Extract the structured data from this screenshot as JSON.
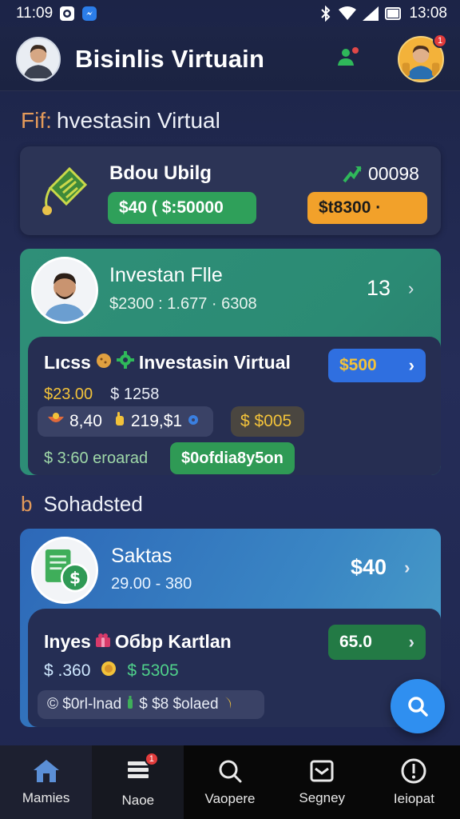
{
  "status_bar": {
    "time": "11:09",
    "clock_right": "13:08"
  },
  "header": {
    "title": "Bisinlis Virtuain",
    "notif_count": "1"
  },
  "section1": {
    "prefix": "Fif:",
    "title": "hvestasin Virtual"
  },
  "summary_card": {
    "title": "Bdou Ubilg",
    "trend_value": "00098",
    "green_pill": "$40 ( $:50000",
    "orange_pill": "$t8300 ·"
  },
  "investor_card": {
    "name": "Investan Flle",
    "values": "$2300 : 1.677 · 6308",
    "count": "13",
    "inner": {
      "title_prefix": "Lıcss",
      "title": "Investasin Virtual",
      "amount_yellow": "$23.00",
      "amount_white": "$ 1258",
      "blue_pill": "$500",
      "chip1": "8,40",
      "chip2": "219,$1",
      "chip3": "$ $005",
      "footer_text": "$ 3:60  eroarad",
      "green_button": "$0ofdia8y5on"
    }
  },
  "section2": {
    "prefix": "b",
    "title": "Sohadsted"
  },
  "sales_card": {
    "title": "Saktas",
    "values": "29.00 - 380",
    "amount": "$40",
    "inner": {
      "title_prefix": "Inyes",
      "title": "Oбbp Kartlan",
      "amount_cyan": "$ .360",
      "amount_green": "$ 5305",
      "green_pill": "65.0",
      "chip_text": "© $0rl-lnad",
      "chip_text2": "$ $8 $olaed"
    }
  },
  "bottom_nav": [
    {
      "label": "Mamies",
      "icon": "home-icon"
    },
    {
      "label": "Naoe",
      "icon": "stack-icon",
      "badge": "1"
    },
    {
      "label": "Vaopere",
      "icon": "search-icon"
    },
    {
      "label": "Segney",
      "icon": "inbox-icon"
    },
    {
      "label": "Ieiopat",
      "icon": "alert-icon"
    }
  ],
  "colors": {
    "background": "#1f2750",
    "teal_card": "#2f8f78",
    "blue_card": "#3a86c4",
    "green_pill": "#2fa05a",
    "orange_pill": "#f2a12a",
    "blue_pill": "#2f6fe0",
    "fab": "#2f8ff0"
  }
}
